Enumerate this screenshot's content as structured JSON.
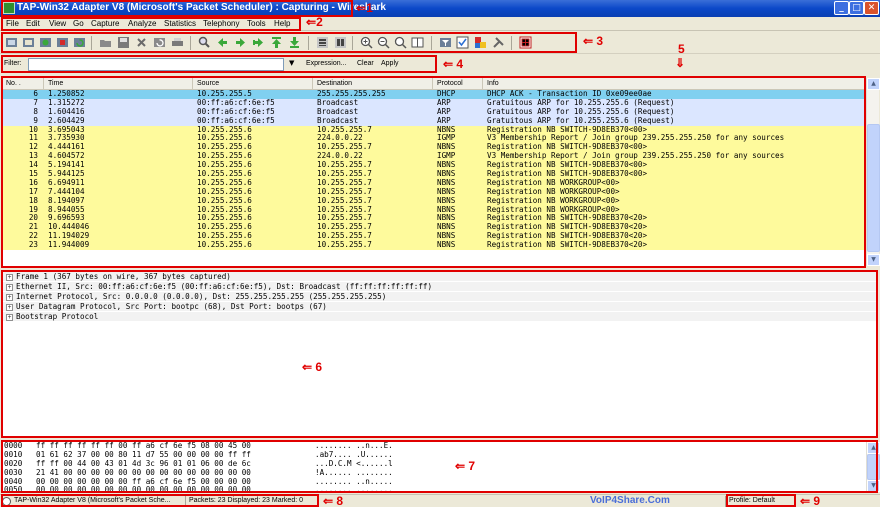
{
  "title": "TAP-Win32 Adapter V8 (Microsoft's Packet Scheduler) : Capturing - Wireshark",
  "window_buttons": {
    "minimize": "_",
    "maximize": "□",
    "close": "✕"
  },
  "menu": [
    "File",
    "Edit",
    "View",
    "Go",
    "Capture",
    "Analyze",
    "Statistics",
    "Telephony",
    "Tools",
    "Help"
  ],
  "filter": {
    "label": "Filter:",
    "value": "",
    "expression": "Expression...",
    "clear": "Clear",
    "apply": "Apply"
  },
  "packet_list": {
    "headers": [
      "No. .",
      "Time",
      "Source",
      "Destination",
      "Protocol",
      "Info"
    ],
    "rows": [
      {
        "no": "6",
        "time": "1.250852",
        "src": "10.255.255.5",
        "dst": "255.255.255.255",
        "proto": "DHCP",
        "info": "DHCP ACK       - Transaction ID 0xe09ee0ae",
        "color": "#80d0f0"
      },
      {
        "no": "7",
        "time": "1.315272",
        "src": "00:ff:a6:cf:6e:f5",
        "dst": "Broadcast",
        "proto": "ARP",
        "info": "Gratuitous ARP for 10.255.255.6 (Request)",
        "color": "#dbe6ff"
      },
      {
        "no": "8",
        "time": "1.604416",
        "src": "00:ff:a6:cf:6e:f5",
        "dst": "Broadcast",
        "proto": "ARP",
        "info": "Gratuitous ARP for 10.255.255.6 (Request)",
        "color": "#dbe6ff"
      },
      {
        "no": "9",
        "time": "2.604429",
        "src": "00:ff:a6:cf:6e:f5",
        "dst": "Broadcast",
        "proto": "ARP",
        "info": "Gratuitous ARP for 10.255.255.6 (Request)",
        "color": "#dbe6ff"
      },
      {
        "no": "10",
        "time": "3.695043",
        "src": "10.255.255.6",
        "dst": "10.255.255.7",
        "proto": "NBNS",
        "info": "Registration NB SWITCH-9D8EB370<00>",
        "color": "#fefa9c"
      },
      {
        "no": "11",
        "time": "3.735930",
        "src": "10.255.255.6",
        "dst": "224.0.0.22",
        "proto": "IGMP",
        "info": "V3 Membership Report / Join group 239.255.255.250 for any sources",
        "color": "#fefa9c"
      },
      {
        "no": "12",
        "time": "4.444161",
        "src": "10.255.255.6",
        "dst": "10.255.255.7",
        "proto": "NBNS",
        "info": "Registration NB SWITCH-9D8EB370<00>",
        "color": "#fefa9c"
      },
      {
        "no": "13",
        "time": "4.604572",
        "src": "10.255.255.6",
        "dst": "224.0.0.22",
        "proto": "IGMP",
        "info": "V3 Membership Report / Join group 239.255.255.250 for any sources",
        "color": "#fefa9c"
      },
      {
        "no": "14",
        "time": "5.194141",
        "src": "10.255.255.6",
        "dst": "10.255.255.7",
        "proto": "NBNS",
        "info": "Registration NB SWITCH-9D8EB370<00>",
        "color": "#fefa9c"
      },
      {
        "no": "15",
        "time": "5.944125",
        "src": "10.255.255.6",
        "dst": "10.255.255.7",
        "proto": "NBNS",
        "info": "Registration NB SWITCH-9D8EB370<00>",
        "color": "#fefa9c"
      },
      {
        "no": "16",
        "time": "6.694911",
        "src": "10.255.255.6",
        "dst": "10.255.255.7",
        "proto": "NBNS",
        "info": "Registration NB WORKGROUP<00>",
        "color": "#fefa9c"
      },
      {
        "no": "17",
        "time": "7.444104",
        "src": "10.255.255.6",
        "dst": "10.255.255.7",
        "proto": "NBNS",
        "info": "Registration NB WORKGROUP<00>",
        "color": "#fefa9c"
      },
      {
        "no": "18",
        "time": "8.194097",
        "src": "10.255.255.6",
        "dst": "10.255.255.7",
        "proto": "NBNS",
        "info": "Registration NB WORKGROUP<00>",
        "color": "#fefa9c"
      },
      {
        "no": "19",
        "time": "8.944055",
        "src": "10.255.255.6",
        "dst": "10.255.255.7",
        "proto": "NBNS",
        "info": "Registration NB WORKGROUP<00>",
        "color": "#fefa9c"
      },
      {
        "no": "20",
        "time": "9.696593",
        "src": "10.255.255.6",
        "dst": "10.255.255.7",
        "proto": "NBNS",
        "info": "Registration NB SWITCH-9D8EB370<20>",
        "color": "#fefa9c"
      },
      {
        "no": "21",
        "time": "10.444046",
        "src": "10.255.255.6",
        "dst": "10.255.255.7",
        "proto": "NBNS",
        "info": "Registration NB SWITCH-9D8EB370<20>",
        "color": "#fefa9c"
      },
      {
        "no": "22",
        "time": "11.194029",
        "src": "10.255.255.6",
        "dst": "10.255.255.7",
        "proto": "NBNS",
        "info": "Registration NB SWITCH-9D8EB370<20>",
        "color": "#fefa9c"
      },
      {
        "no": "23",
        "time": "11.944009",
        "src": "10.255.255.6",
        "dst": "10.255.255.7",
        "proto": "NBNS",
        "info": "Registration NB SWITCH-9D8EB370<20>",
        "color": "#fefa9c"
      }
    ]
  },
  "details": [
    "Frame 1 (367 bytes on wire, 367 bytes captured)",
    "Ethernet II, Src: 00:ff:a6:cf:6e:f5 (00:ff:a6:cf:6e:f5), Dst: Broadcast (ff:ff:ff:ff:ff:ff)",
    "Internet Protocol, Src: 0.0.0.0 (0.0.0.0), Dst: 255.255.255.255 (255.255.255.255)",
    "User Datagram Protocol, Src Port: bootpc (68), Dst Port: bootps (67)",
    "Bootstrap Protocol"
  ],
  "hex": [
    {
      "offset": "0000",
      "bytes": "ff ff ff ff ff ff 00 ff  a6 cf 6e f5 08 00 45 00",
      "ascii": "........ ..n...E."
    },
    {
      "offset": "0010",
      "bytes": "01 61 62 37 00 00 80 11  d7 55 00 00 00 00 ff ff",
      "ascii": ".ab7.... .U......"
    },
    {
      "offset": "0020",
      "bytes": "ff ff 00 44 00 43 01 4d  3c 96 01 01 06 00 de 6c",
      "ascii": "...D.C.M <......l"
    },
    {
      "offset": "0030",
      "bytes": "21 41 00 00 00 00 00 00  00 00 00 00 00 00 00 00",
      "ascii": "!A...... ........"
    },
    {
      "offset": "0040",
      "bytes": "00 00 00 00 00 00 00 ff  a6 cf 6e f5 00 00 00 00",
      "ascii": "........ ..n....."
    },
    {
      "offset": "0050",
      "bytes": "00 00 00 00 00 00 00 00  00 00 00 00 00 00 00 00",
      "ascii": "........ ........"
    }
  ],
  "status": {
    "interface": "TAP-Win32 Adapter V8 (Microsoft's Packet Sche...",
    "packets": "Packets: 23 Displayed: 23 Marked: 0",
    "watermark": "VoIP4Share.Com",
    "profile": "Profile: Default"
  },
  "callouts": [
    "1",
    "2",
    "3",
    "4",
    "5",
    "6",
    "7",
    "8",
    "9"
  ],
  "colors": {
    "highlight": "#e00000",
    "dhcp_row": "#80d0f0",
    "arp_row": "#dbe6ff",
    "nbns_row": "#fefa9c"
  },
  "toolbar_icons": [
    "interface-list-icon",
    "capture-options-icon",
    "start-capture-icon",
    "stop-capture-icon",
    "restart-capture-icon",
    "open-file-icon",
    "save-file-icon",
    "close-file-icon",
    "reload-icon",
    "print-icon",
    "find-icon",
    "go-back-icon",
    "go-forward-icon",
    "go-to-packet-icon",
    "go-first-icon",
    "go-last-icon",
    "colorize-icon",
    "auto-scroll-icon",
    "zoom-in-icon",
    "zoom-out-icon",
    "zoom-normal-icon",
    "resize-columns-icon",
    "capture-filters-icon",
    "display-filters-icon",
    "coloring-rules-icon",
    "preferences-icon",
    "help-icon"
  ]
}
